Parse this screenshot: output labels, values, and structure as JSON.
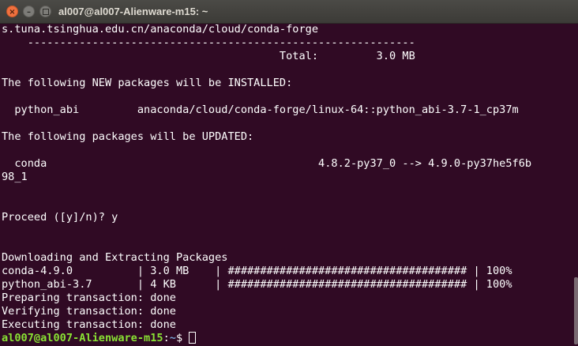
{
  "window": {
    "title": "al007@al007-Alienware-m15: ~"
  },
  "terminal": {
    "lines": [
      "s.tuna.tsinghua.edu.cn/anaconda/cloud/conda-forge",
      "    ------------------------------------------------------------",
      "                                           Total:         3.0 MB",
      "",
      "The following NEW packages will be INSTALLED:",
      "",
      "  python_abi         anaconda/cloud/conda-forge/linux-64::python_abi-3.7-1_cp37m",
      "",
      "The following packages will be UPDATED:",
      "",
      "  conda                                          4.8.2-py37_0 --> 4.9.0-py37he5f6b",
      "98_1",
      "",
      "",
      "Proceed ([y]/n)? y",
      "",
      "",
      "Downloading and Extracting Packages",
      "conda-4.9.0          | 3.0 MB    | ##################################### | 100%",
      "python_abi-3.7       | 4 KB      | ##################################### | 100%",
      "Preparing transaction: done",
      "Verifying transaction: done",
      "Executing transaction: done"
    ],
    "prompt": {
      "user_host": "al007@al007-Alienware-m15",
      "separator": ":",
      "path": "~",
      "symbol": "$ "
    }
  }
}
